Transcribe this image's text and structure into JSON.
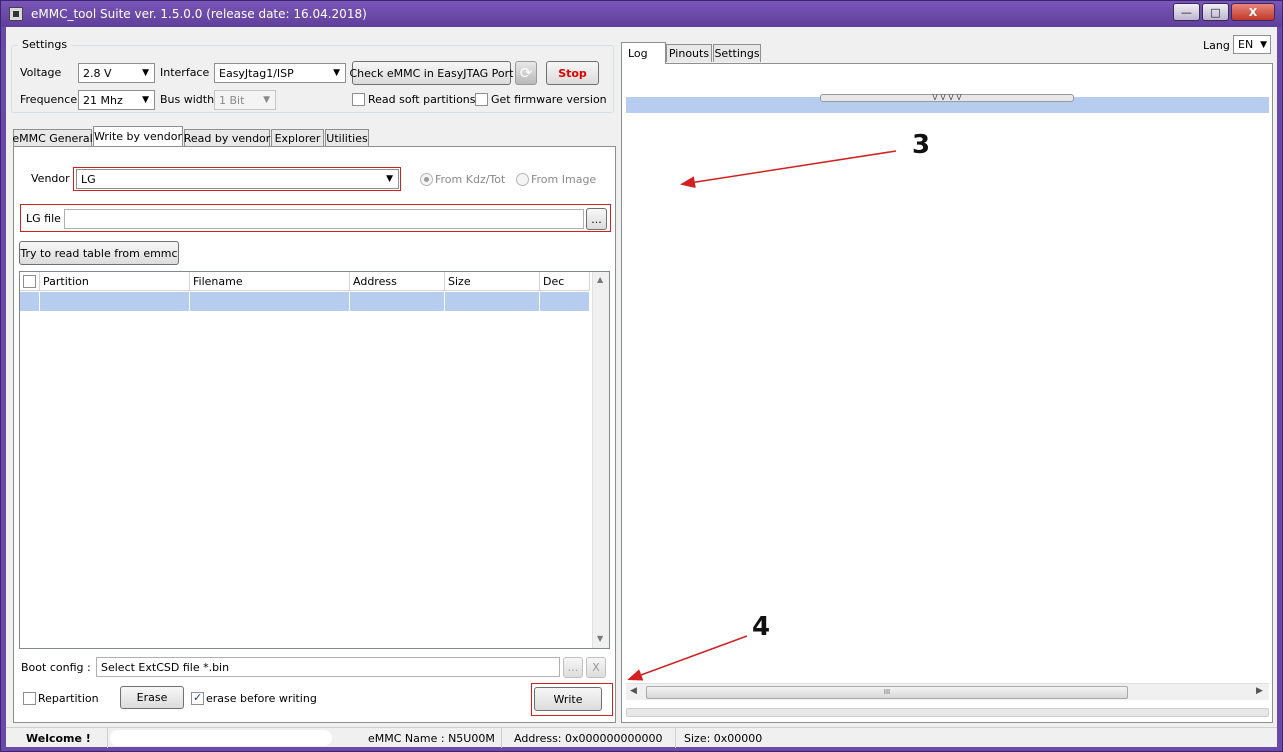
{
  "window": {
    "title": "eMMC_tool Suite  ver. 1.5.0.0 (release date: 16.04.2018)",
    "min_label": "—",
    "max_label": "□",
    "close_label": "X"
  },
  "settings": {
    "group_label": "Settings",
    "voltage_label": "Voltage",
    "voltage_value": "2.8 V",
    "interface_label": "Interface",
    "interface_value": "EasyJtag1/ISP",
    "check_button": "Check eMMC in EasyJTAG Port",
    "stop_button": "Stop",
    "frequence_label": "Frequence",
    "frequence_value": "21 Mhz",
    "bus_width_label": "Bus width",
    "bus_width_value": "1 Bit",
    "read_soft_partitions": "Read soft partitions",
    "get_firmware_version": "Get firmware version"
  },
  "left_tabs": [
    {
      "label": "eMMC General"
    },
    {
      "label": "Write by vendor"
    },
    {
      "label": "Read by vendor"
    },
    {
      "label": "Explorer"
    },
    {
      "label": "Utilities"
    }
  ],
  "vendor": {
    "label": "Vendor",
    "value": "LG",
    "from_kdz": "From Kdz/Tot",
    "from_image": "From Image"
  },
  "lg_file": {
    "label": "LG file",
    "value": "",
    "browse": "..."
  },
  "try_read_button": "Try to read table from emmc",
  "partition_table": {
    "columns": [
      "Partition",
      "Filename",
      "Address",
      "Size",
      "Dec"
    ]
  },
  "boot_config": {
    "label": "Boot config  :",
    "value": "Select ExtCSD file *.bin",
    "browse": "...",
    "clear": "X"
  },
  "bottom": {
    "repartition": "Repartition",
    "erase_button": "Erase",
    "erase_before_writing": "erase before writing",
    "write_button": "Write"
  },
  "right_tabs": [
    {
      "label": "Log"
    },
    {
      "label": "Pinouts"
    },
    {
      "label": "Settings"
    }
  ],
  "lang": {
    "label": "Lang",
    "value": "EN"
  },
  "log_splitter": "V V V V",
  "hscroll_grip": "III",
  "annotations": {
    "three": "3",
    "four": "4"
  },
  "status_bar": {
    "welcome": "Welcome !",
    "emmc_name": "eMMC Name : N5U00M",
    "address": "Address: 0x000000000000",
    "size": "Size: 0x00000"
  },
  "colors": {
    "title_bar": "#6a4aa8",
    "selection": "#b7cdf0",
    "annotation_red": "#d32020",
    "stop_text": "#e00000"
  }
}
